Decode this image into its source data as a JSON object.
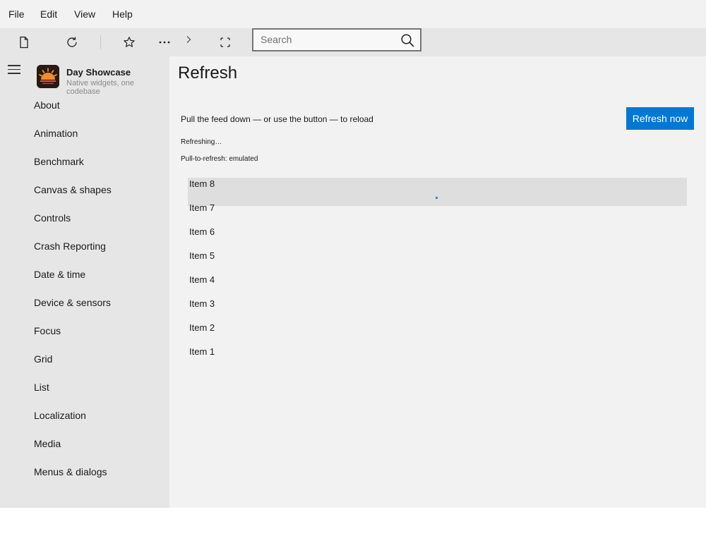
{
  "menu": {
    "file": "File",
    "edit": "Edit",
    "view": "View",
    "help": "Help"
  },
  "toolbar": {
    "icons": [
      "document-icon",
      "refresh-icon",
      "star-icon",
      "more-icon",
      "chevron-right-icon",
      "fullscreen-icon"
    ],
    "search_placeholder": "Search"
  },
  "sidebar": {
    "brand_title": "Day Showcase",
    "brand_subtitle": "Native widgets, one codebase",
    "items": [
      {
        "label": "About"
      },
      {
        "label": "Animation"
      },
      {
        "label": "Benchmark"
      },
      {
        "label": "Canvas & shapes"
      },
      {
        "label": "Controls"
      },
      {
        "label": "Crash Reporting"
      },
      {
        "label": "Date & time"
      },
      {
        "label": "Device & sensors"
      },
      {
        "label": "Focus"
      },
      {
        "label": "Grid"
      },
      {
        "label": "List"
      },
      {
        "label": "Localization"
      },
      {
        "label": "Media"
      },
      {
        "label": "Menus & dialogs"
      }
    ]
  },
  "main": {
    "title": "Refresh",
    "instruction": "Pull the feed down — or use the button — to reload",
    "refresh_button": "Refresh now",
    "status": "Refreshing…",
    "mode": "Pull-to-refresh: emulated",
    "items": [
      "Item 8",
      "Item 7",
      "Item 6",
      "Item 5",
      "Item 4",
      "Item 3",
      "Item 2",
      "Item 1"
    ]
  },
  "colors": {
    "accent": "#0078d4",
    "sidebar_bg": "#e6e6e6",
    "content_bg": "#f2f2f2"
  }
}
